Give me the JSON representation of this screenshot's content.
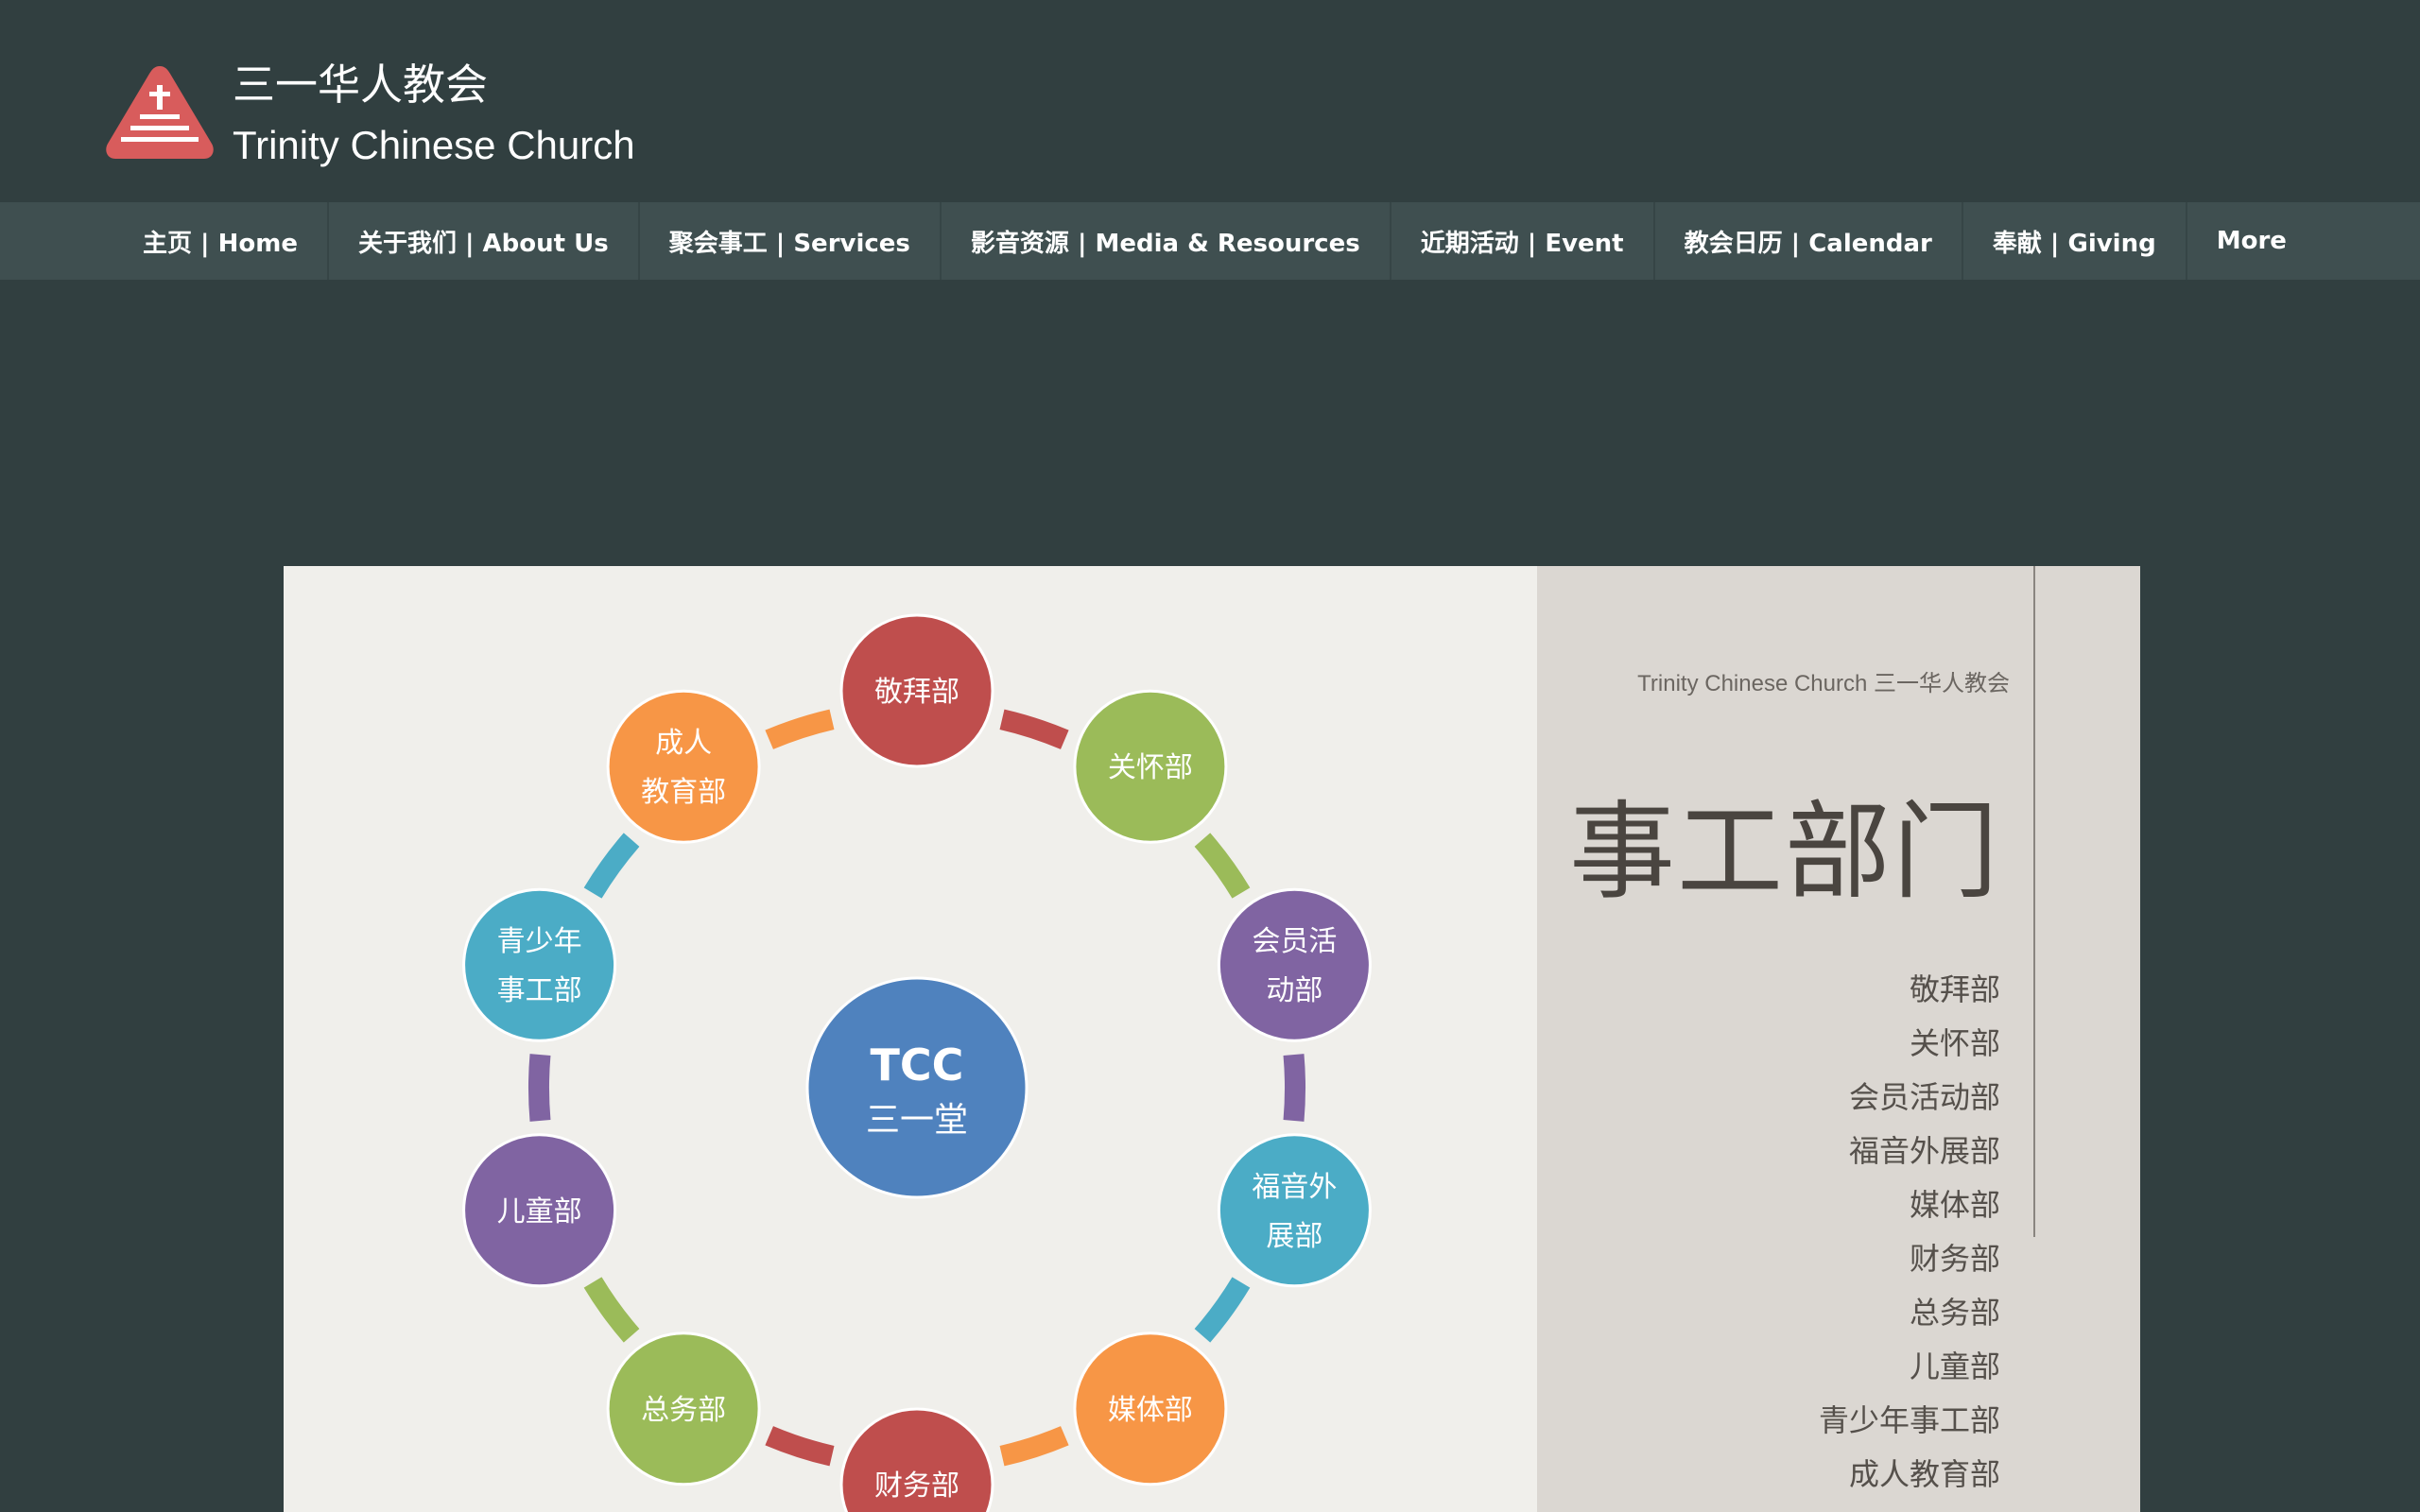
{
  "brand": {
    "name_cn": "三一华人教会",
    "name_en": "Trinity Chinese Church"
  },
  "nav": [
    {
      "label": "主页 | Home"
    },
    {
      "label": "关于我们 | About Us"
    },
    {
      "label": "聚会事工 | Services"
    },
    {
      "label": "影音资源 | Media & Resources"
    },
    {
      "label": "近期活动 | Event"
    },
    {
      "label": "教会日历 | Calendar"
    },
    {
      "label": "奉献 | Giving"
    },
    {
      "label": "More"
    }
  ],
  "diagram": {
    "center": {
      "line1": "TCC",
      "line2": "三一堂",
      "color": "#4f82be"
    },
    "nodes": [
      {
        "lines": [
          "敬拜部"
        ],
        "color": "#bf4e4d"
      },
      {
        "lines": [
          "关怀部"
        ],
        "color": "#9bbb59"
      },
      {
        "lines": [
          "会员活",
          "动部"
        ],
        "color": "#8064a2"
      },
      {
        "lines": [
          "福音外",
          "展部"
        ],
        "color": "#4bacc6"
      },
      {
        "lines": [
          "媒体部"
        ],
        "color": "#f79646"
      },
      {
        "lines": [
          "财务部"
        ],
        "color": "#bf4e4d"
      },
      {
        "lines": [
          "总务部"
        ],
        "color": "#9bbb59"
      },
      {
        "lines": [
          "儿童部"
        ],
        "color": "#8064a2"
      },
      {
        "lines": [
          "青少年",
          "事工部"
        ],
        "color": "#4bacc6"
      },
      {
        "lines": [
          "成人",
          "教育部"
        ],
        "color": "#f79646"
      }
    ]
  },
  "sidebar": {
    "subtitle": "Trinity Chinese Church  三一华人教会",
    "title": "事工部门",
    "departments": [
      "敬拜部",
      "关怀部",
      "会员活动部",
      "福音外展部",
      "媒体部",
      "财务部",
      "总务部",
      "儿童部",
      "青少年事工部",
      "成人教育部"
    ]
  },
  "colors": {
    "background": "#313f40",
    "nav_background": "#3f4f50",
    "logo_red": "#d85c5c"
  }
}
